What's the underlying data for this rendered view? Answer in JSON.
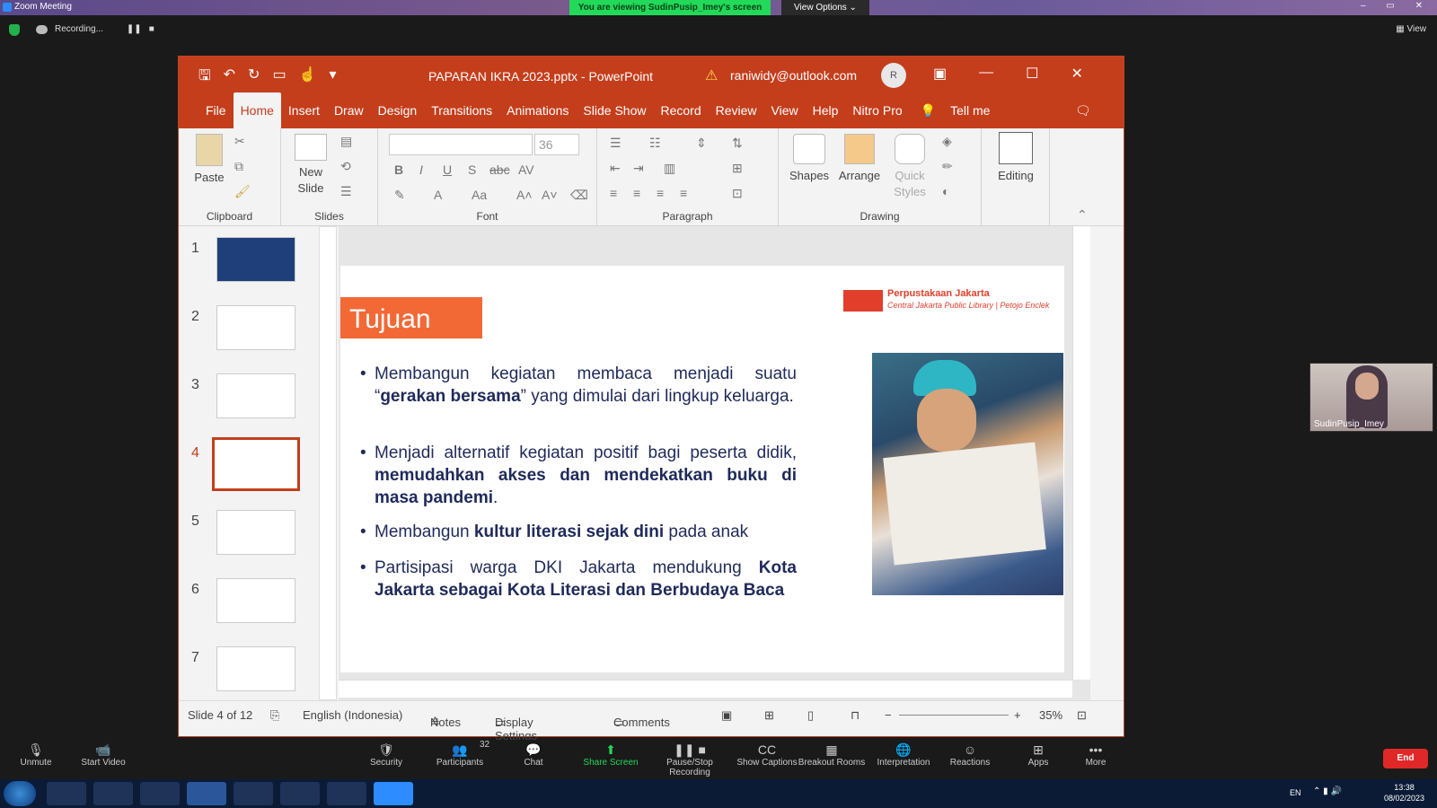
{
  "zoom": {
    "window_title": "Zoom Meeting",
    "banner": "You are viewing SudinPusip_Imey's screen",
    "view_options": "View Options ⌄",
    "recording": "Recording...",
    "view_label": "View",
    "participant_name": "SudinPusip_Imey",
    "participants_count": "32",
    "toolbar": [
      {
        "label": "Unmute",
        "icon": "mic-off-icon"
      },
      {
        "label": "Start Video",
        "icon": "video-off-icon"
      },
      {
        "label": "Security",
        "icon": "shield-icon"
      },
      {
        "label": "Participants",
        "icon": "people-icon"
      },
      {
        "label": "Chat",
        "icon": "chat-icon"
      },
      {
        "label": "Share Screen",
        "icon": "share-icon"
      },
      {
        "label": "Pause/Stop Recording",
        "icon": "record-icon"
      },
      {
        "label": "Show Captions",
        "icon": "cc-icon"
      },
      {
        "label": "Breakout Rooms",
        "icon": "grid-icon"
      },
      {
        "label": "Interpretation",
        "icon": "globe-icon"
      },
      {
        "label": "Reactions",
        "icon": "emoji-icon"
      },
      {
        "label": "Apps",
        "icon": "apps-icon"
      },
      {
        "label": "More",
        "icon": "more-icon"
      }
    ],
    "end": "End"
  },
  "ppt": {
    "doc_title": "PAPARAN IKRA 2023.pptx  -  PowerPoint",
    "account": "raniwidy@outlook.com",
    "avatar": "R",
    "tabs": [
      "File",
      "Home",
      "Insert",
      "Draw",
      "Design",
      "Transitions",
      "Animations",
      "Slide Show",
      "Record",
      "Review",
      "View",
      "Help",
      "Nitro Pro"
    ],
    "tell_me": "Tell me",
    "ribbon": {
      "paste": "Paste",
      "new_slide_1": "New",
      "new_slide_2": "Slide",
      "font_size": "36",
      "shapes": "Shapes",
      "arrange": "Arrange",
      "quick_styles_1": "Quick",
      "quick_styles_2": "Styles",
      "editing": "Editing",
      "groups": [
        "Clipboard",
        "Slides",
        "Font",
        "Paragraph",
        "Drawing"
      ]
    },
    "thumbs": [
      "1",
      "2",
      "3",
      "4",
      "5",
      "6",
      "7"
    ],
    "slide": {
      "title": "Tujuan",
      "logo_1": "Perpustakaan Jakarta",
      "logo_2": "Central Jakarta Public Library | Petojo Enclek",
      "b1a": "Membangun kegiatan membaca menjadi suatu “",
      "b1b": "gerakan bersama",
      "b1c": "” yang dimulai dari lingkup keluarga.",
      "b2a": "Menjadi alternatif kegiatan positif bagi peserta didik, ",
      "b2b": "memudahkan akses dan mendekatkan buku di masa pandemi",
      "b2c": ".",
      "b3a": "Membangun ",
      "b3b": "kultur literasi sejak dini",
      "b3c": " pada anak",
      "b4a": "Partisipasi warga DKI Jakarta mendukung ",
      "b4b": "Kota Jakarta sebagai Kota Literasi dan Berbudaya Baca"
    },
    "status": {
      "slide": "Slide 4 of 12",
      "lang": "English (Indonesia)",
      "notes": "Notes",
      "display": "Display Settings",
      "comments": "Comments",
      "zoom": "35%"
    }
  },
  "taskbar": {
    "lang": "EN",
    "time": "13:38",
    "date": "08/02/2023"
  }
}
